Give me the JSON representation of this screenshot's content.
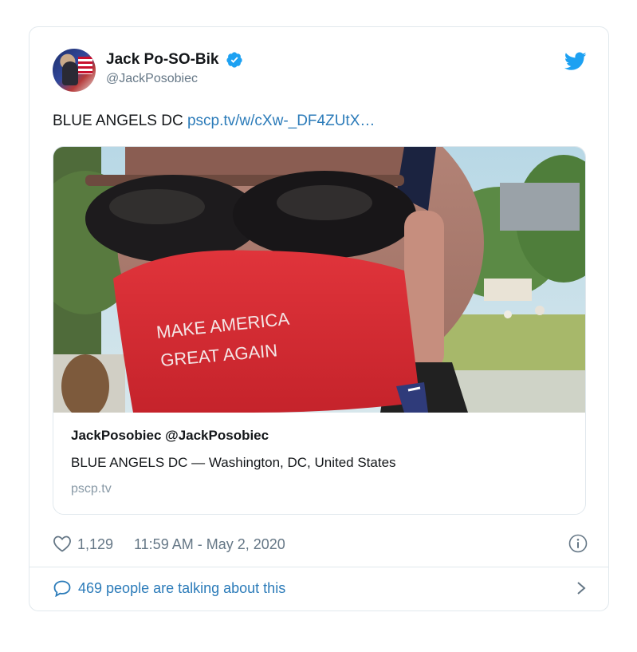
{
  "author": {
    "display_name": "Jack Po-SO-Bik",
    "handle": "@JackPosobiec",
    "avatar_icon": "user-avatar",
    "verified_icon": "verified-badge-icon"
  },
  "brand_icon": "twitter-bird-icon",
  "tweet": {
    "text": "BLUE ANGELS DC",
    "link_text": "pscp.tv/w/cXw-_DF4ZUtX…"
  },
  "card": {
    "title": "JackPosobiec @JackPosobiec",
    "description": "BLUE ANGELS DC — Washington, DC, United States",
    "domain": "pscp.tv",
    "image_mask_text_line1": "MAKE AMERICA",
    "image_mask_text_line2": "GREAT AGAIN"
  },
  "footer": {
    "like_count": "1,129",
    "timestamp": "11:59 AM - May 2, 2020",
    "like_icon": "heart-icon",
    "info_icon": "info-icon"
  },
  "conversation": {
    "label": "469 people are talking about this",
    "icon": "speech-bubble-icon",
    "chevron_icon": "chevron-right-icon"
  },
  "colors": {
    "link_blue": "#2b7bb9",
    "twitter_blue": "#1da1f2",
    "secondary_text": "#657786",
    "border": "#e1e8ed",
    "mask_red": "#d8262f"
  }
}
